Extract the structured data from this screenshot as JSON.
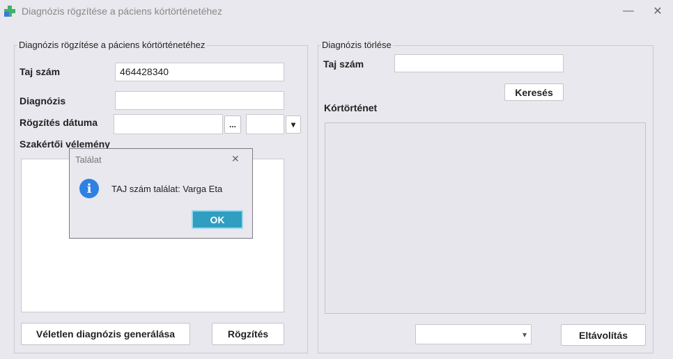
{
  "window": {
    "title": "Diagnózis rögzítése a páciens kórtörténetéhez",
    "minimize_glyph": "—",
    "close_glyph": "✕"
  },
  "left_panel": {
    "legend": "Diagnózis rögzítése a páciens kórtörténetéhez",
    "taj_label": "Taj szám",
    "taj_value": "464428340",
    "diag_label": "Diagnózis",
    "diag_value": "",
    "date_label": "Rögzítés dátuma",
    "date_value": "",
    "date_picker_label": "...",
    "time_value": "",
    "time_arrow": "▾",
    "opinion_label": "Szakértői vélemény",
    "opinion_value": "",
    "random_button": "Véletlen diagnózis generálása",
    "save_button": "Rögzítés"
  },
  "right_panel": {
    "legend": "Diagnózis törlése",
    "taj_label": "Taj szám",
    "taj_value": "",
    "search_button": "Keresés",
    "history_label": "Kórtörténet",
    "select_value": "",
    "select_arrow": "▾",
    "remove_button": "Eltávolítás"
  },
  "dialog": {
    "title": "Találat",
    "message": "TAJ szám találat: Varga Eta",
    "ok_button": "OK",
    "close_glyph": "✕",
    "info_glyph": "i",
    "info_color": "#2f80e0"
  },
  "colors": {
    "accent": "#2f9ec0",
    "app_icon_green": "#3fb26b",
    "app_icon_blue": "#3a78d8"
  }
}
